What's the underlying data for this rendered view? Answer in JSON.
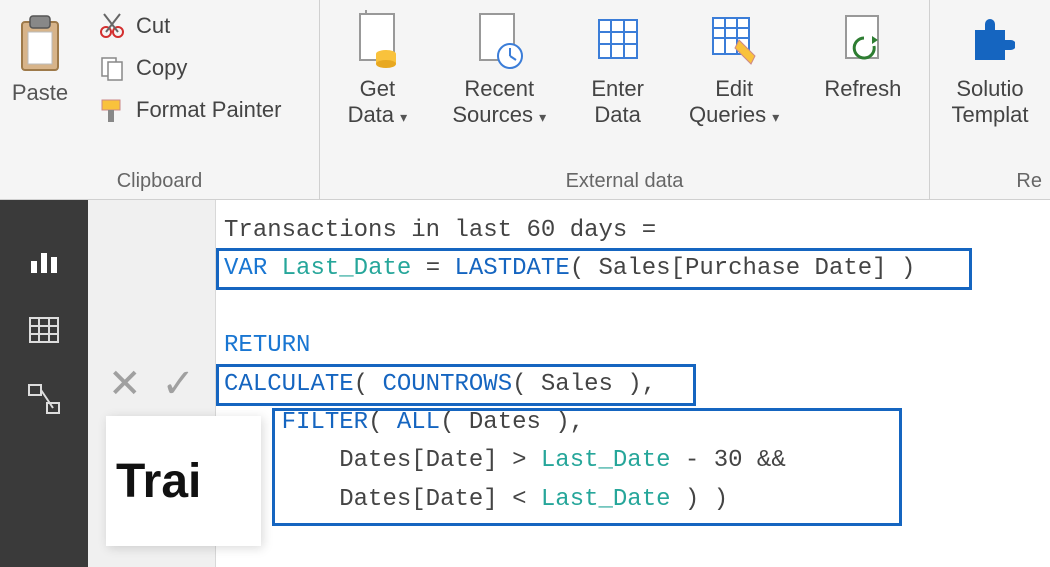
{
  "ribbon": {
    "clipboard": {
      "label": "Clipboard",
      "paste": "Paste",
      "cut": "Cut",
      "copy": "Copy",
      "format_painter": "Format Painter"
    },
    "external": {
      "label": "External data",
      "get_data": "Get\nData",
      "recent_sources": "Recent\nSources",
      "enter_data": "Enter\nData",
      "edit_queries": "Edit\nQueries",
      "refresh": "Refresh"
    },
    "resources": {
      "label": "Re",
      "solution_templates": "Solutio\nTemplat"
    }
  },
  "formula": {
    "line1_a": "Transactions in last 60 days = ",
    "line2_var": "VAR",
    "line2_name": " Last_Date ",
    "line2_eq": "= ",
    "line2_fn": "LASTDATE",
    "line2_arg": "( Sales[Purchase Date] )",
    "line4_return": "RETURN",
    "line5_calc": "CALCULATE",
    "line5_a": "( ",
    "line5_count": "COUNTROWS",
    "line5_b": "( Sales ),",
    "line6_pad": "    ",
    "line6_filter": "FILTER",
    "line6_a": "( ",
    "line6_all": "ALL",
    "line6_b": "( Dates ),",
    "line7_pad": "        Dates[Date] > ",
    "line7_var": "Last_Date",
    "line7_b": " - 30 &&",
    "line8_pad": "        Dates[Date] < ",
    "line8_var": "Last_Date",
    "line8_b": " ) )"
  },
  "report": {
    "peek": "Trai"
  },
  "icons": {
    "cancel": "✕",
    "confirm": "✓",
    "dropdown": "▾"
  }
}
